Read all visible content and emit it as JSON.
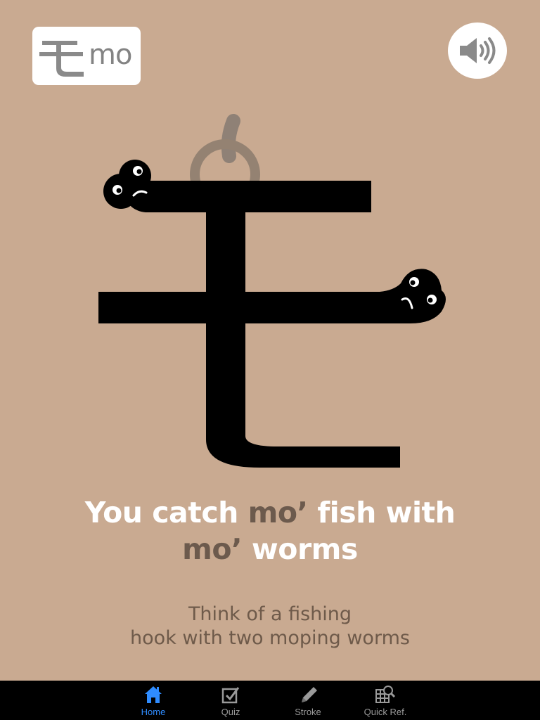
{
  "kana": {
    "character": "も",
    "romaji": "mo"
  },
  "sound_button": {
    "icon": "speaker-icon"
  },
  "mnemonic": {
    "part1": "You catch ",
    "accent1": "mo’",
    "part2": " fish with",
    "accent2": "mo’",
    "part3": " worms"
  },
  "hint": {
    "line1": "Think of a fishing",
    "line2": "hook with two moping worms"
  },
  "tabs": [
    {
      "label": "Home",
      "icon": "home-icon",
      "active": true
    },
    {
      "label": "Quiz",
      "icon": "checkbox-icon",
      "active": false
    },
    {
      "label": "Stroke",
      "icon": "pencil-icon",
      "active": false
    },
    {
      "label": "Quick Ref.",
      "icon": "grid-search-icon",
      "active": false
    }
  ],
  "colors": {
    "background": "#c9aa91",
    "accent_text": "#6c5a4d",
    "active_tab": "#2f8cff",
    "inactive_tab": "#9a9a9a"
  }
}
